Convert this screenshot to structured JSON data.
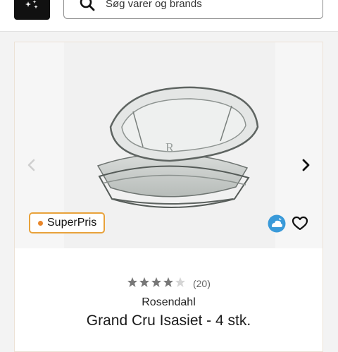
{
  "header": {
    "search": {
      "placeholder": "Søg varer og brands"
    }
  },
  "product": {
    "badge": "SuperPris",
    "rating": {
      "value": 4.5,
      "max": 5,
      "count": "(20)"
    },
    "brand": "Rosendahl",
    "title": "Grand Cru Isasiet - 4 stk."
  },
  "colors": {
    "badge_border": "#e8a23b",
    "badge_dot": "#e8862a",
    "eco_badge": "#3a9ad9",
    "star_filled": "#777777"
  },
  "icons": [
    "menu-icon",
    "search-icon",
    "chevron-left-icon",
    "chevron-right-icon",
    "eco-cloud-icon",
    "heart-icon",
    "star-icon"
  ]
}
